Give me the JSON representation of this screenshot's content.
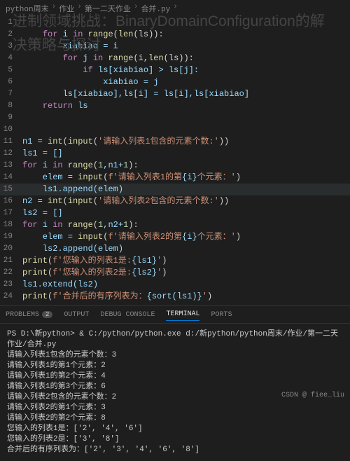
{
  "breadcrumb": [
    "python周末",
    "作业",
    "第一二天作业",
    "合并.py"
  ],
  "overlay_title": "进制领域挑战：BinaryDomainConfiguration的解决策略与探讨",
  "code_lines": [
    {
      "n": 1,
      "tokens": [
        {
          "t": "    ",
          "c": ""
        }
      ]
    },
    {
      "n": 2,
      "tokens": [
        {
          "t": "    ",
          "c": ""
        },
        {
          "t": "for",
          "c": "kw"
        },
        {
          "t": " i ",
          "c": "var"
        },
        {
          "t": "in",
          "c": "kw"
        },
        {
          "t": " ",
          "c": ""
        },
        {
          "t": "range",
          "c": "fn"
        },
        {
          "t": "(",
          "c": ""
        },
        {
          "t": "len",
          "c": "fn"
        },
        {
          "t": "(ls)):",
          "c": ""
        }
      ]
    },
    {
      "n": 3,
      "tokens": [
        {
          "t": "        xiabiao = i",
          "c": "var"
        }
      ]
    },
    {
      "n": 4,
      "tokens": [
        {
          "t": "        ",
          "c": ""
        },
        {
          "t": "for",
          "c": "kw"
        },
        {
          "t": " j ",
          "c": "var"
        },
        {
          "t": "in",
          "c": "kw"
        },
        {
          "t": " ",
          "c": ""
        },
        {
          "t": "range",
          "c": "fn"
        },
        {
          "t": "(i,",
          "c": ""
        },
        {
          "t": "len",
          "c": "fn"
        },
        {
          "t": "(ls)):",
          "c": ""
        }
      ]
    },
    {
      "n": 5,
      "tokens": [
        {
          "t": "            ",
          "c": ""
        },
        {
          "t": "if",
          "c": "kw"
        },
        {
          "t": " ls[xiabiao] > ls[j]:",
          "c": "var"
        }
      ]
    },
    {
      "n": 6,
      "tokens": [
        {
          "t": "                xiabiao = j",
          "c": "var"
        }
      ]
    },
    {
      "n": 7,
      "tokens": [
        {
          "t": "        ls[xiabiao],ls[i] = ls[i],ls[xiabiao]",
          "c": "var"
        }
      ]
    },
    {
      "n": 8,
      "tokens": [
        {
          "t": "    ",
          "c": ""
        },
        {
          "t": "return",
          "c": "kw"
        },
        {
          "t": " ls",
          "c": "var"
        }
      ]
    },
    {
      "n": 9,
      "tokens": []
    },
    {
      "n": 10,
      "tokens": []
    },
    {
      "n": 11,
      "tokens": [
        {
          "t": "n1 = ",
          "c": "var"
        },
        {
          "t": "int",
          "c": "fn"
        },
        {
          "t": "(",
          "c": ""
        },
        {
          "t": "input",
          "c": "fn"
        },
        {
          "t": "(",
          "c": ""
        },
        {
          "t": "'请输入列表1包含的元素个数:'",
          "c": "str"
        },
        {
          "t": "))",
          "c": ""
        }
      ]
    },
    {
      "n": 12,
      "tokens": [
        {
          "t": "ls1 = []",
          "c": "var"
        }
      ]
    },
    {
      "n": 13,
      "tokens": [
        {
          "t": "for",
          "c": "kw"
        },
        {
          "t": " i ",
          "c": "var"
        },
        {
          "t": "in",
          "c": "kw"
        },
        {
          "t": " ",
          "c": ""
        },
        {
          "t": "range",
          "c": "fn"
        },
        {
          "t": "(",
          "c": ""
        },
        {
          "t": "1",
          "c": "num"
        },
        {
          "t": ",n1+",
          "c": "var"
        },
        {
          "t": "1",
          "c": "num"
        },
        {
          "t": "):",
          "c": ""
        }
      ]
    },
    {
      "n": 14,
      "tokens": [
        {
          "t": "    elem = ",
          "c": "var"
        },
        {
          "t": "input",
          "c": "fn"
        },
        {
          "t": "(",
          "c": ""
        },
        {
          "t": "f'请输入列表1的第",
          "c": "str"
        },
        {
          "t": "{i}",
          "c": "var"
        },
        {
          "t": "个元素：'",
          "c": "str"
        },
        {
          "t": ")",
          "c": ""
        }
      ]
    },
    {
      "n": 15,
      "hl": true,
      "tokens": [
        {
          "t": "    ls1.append(elem)",
          "c": "var"
        }
      ]
    },
    {
      "n": 16,
      "tokens": [
        {
          "t": "n2 = ",
          "c": "var"
        },
        {
          "t": "int",
          "c": "fn"
        },
        {
          "t": "(",
          "c": ""
        },
        {
          "t": "input",
          "c": "fn"
        },
        {
          "t": "(",
          "c": ""
        },
        {
          "t": "'请输入列表2包含的元素个数:'",
          "c": "str"
        },
        {
          "t": "))",
          "c": ""
        }
      ]
    },
    {
      "n": 17,
      "tokens": [
        {
          "t": "ls2 = []",
          "c": "var"
        }
      ]
    },
    {
      "n": 18,
      "tokens": [
        {
          "t": "for",
          "c": "kw"
        },
        {
          "t": " i ",
          "c": "var"
        },
        {
          "t": "in",
          "c": "kw"
        },
        {
          "t": " ",
          "c": ""
        },
        {
          "t": "range",
          "c": "fn"
        },
        {
          "t": "(",
          "c": ""
        },
        {
          "t": "1",
          "c": "num"
        },
        {
          "t": ",n2+",
          "c": "var"
        },
        {
          "t": "1",
          "c": "num"
        },
        {
          "t": "):",
          "c": ""
        }
      ]
    },
    {
      "n": 19,
      "tokens": [
        {
          "t": "    elem = ",
          "c": "var"
        },
        {
          "t": "input",
          "c": "fn"
        },
        {
          "t": "(",
          "c": ""
        },
        {
          "t": "f'请输入列表2的第",
          "c": "str"
        },
        {
          "t": "{i}",
          "c": "var"
        },
        {
          "t": "个元素：'",
          "c": "str"
        },
        {
          "t": ")",
          "c": ""
        }
      ]
    },
    {
      "n": 20,
      "tokens": [
        {
          "t": "    ls2.append(elem)",
          "c": "var"
        }
      ]
    },
    {
      "n": 21,
      "tokens": [
        {
          "t": "print",
          "c": "fn"
        },
        {
          "t": "(",
          "c": ""
        },
        {
          "t": "f'您输入的列表1是:",
          "c": "str"
        },
        {
          "t": "{ls1}",
          "c": "var"
        },
        {
          "t": "'",
          "c": "str"
        },
        {
          "t": ")",
          "c": ""
        }
      ]
    },
    {
      "n": 22,
      "tokens": [
        {
          "t": "print",
          "c": "fn"
        },
        {
          "t": "(",
          "c": ""
        },
        {
          "t": "f'您输入的列表2是:",
          "c": "str"
        },
        {
          "t": "{ls2}",
          "c": "var"
        },
        {
          "t": "'",
          "c": "str"
        },
        {
          "t": ")",
          "c": ""
        }
      ]
    },
    {
      "n": 23,
      "tokens": [
        {
          "t": "ls1.extend(ls2)",
          "c": "var"
        }
      ]
    },
    {
      "n": 24,
      "tokens": [
        {
          "t": "print",
          "c": "fn"
        },
        {
          "t": "(",
          "c": ""
        },
        {
          "t": "f'合并后的有序列表为：",
          "c": "str"
        },
        {
          "t": "{sort(ls1)}",
          "c": "var"
        },
        {
          "t": "'",
          "c": "str"
        },
        {
          "t": ")",
          "c": ""
        }
      ]
    }
  ],
  "panel_tabs": {
    "problems": "PROBLEMS",
    "problems_count": "2",
    "output": "OUTPUT",
    "debug": "DEBUG CONSOLE",
    "terminal": "TERMINAL",
    "ports": "PORTS"
  },
  "terminal_lines": [
    "PS D:\\新python> & C:/python/python.exe d:/新python/python周末/作业/第一二天作业/合并.py",
    "请输入列表1包含的元素个数：3",
    "请输入列表1的第1个元素：2",
    "请输入列表1的第2个元素：4",
    "请输入列表1的第3个元素：6",
    "请输入列表2包含的元素个数：2",
    "请输入列表2的第1个元素：3",
    "请输入列表2的第2个元素：8",
    "您输入的列表1是：['2', '4', '6']",
    "您输入的列表2是：['3', '8']",
    "合并后的有序列表为：['2', '3', '4', '6', '8']"
  ],
  "watermark": "CSDN @ fiee_liu"
}
